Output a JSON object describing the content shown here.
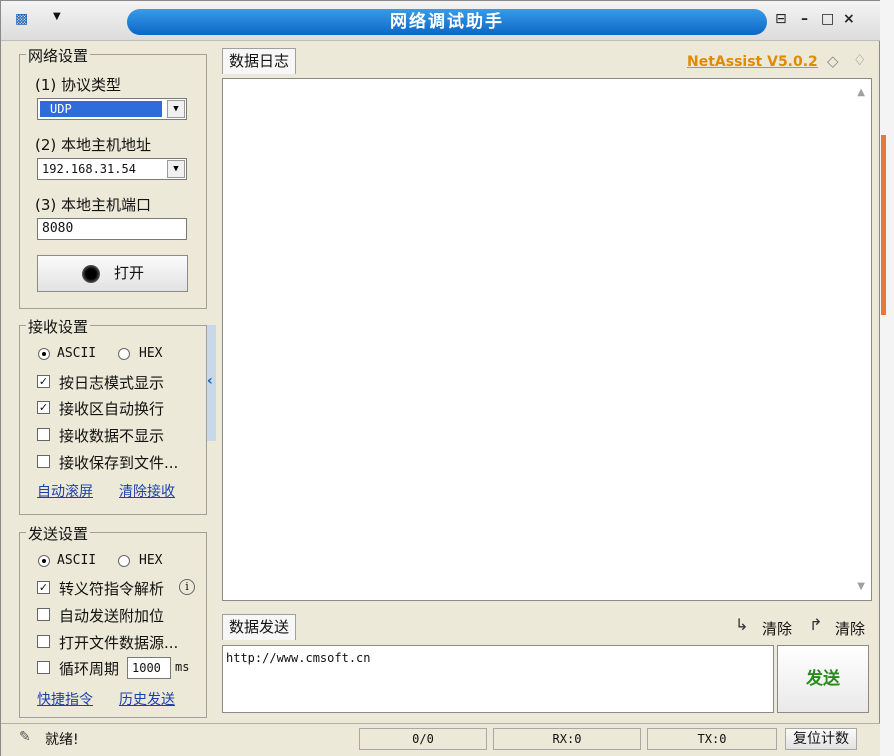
{
  "window": {
    "title": "网络调试助手",
    "controls": [
      "⊟",
      "–",
      "□",
      "×"
    ]
  },
  "network": {
    "group_title": "网络设置",
    "protocol_label": "(1) 协议类型",
    "protocol_value": "UDP",
    "host_label": "(2) 本地主机地址",
    "host_value": "192.168.31.54",
    "port_label": "(3) 本地主机端口",
    "port_value": "8080",
    "open_button": "打开"
  },
  "receive": {
    "group_title": "接收设置",
    "mode_ascii": "ASCII",
    "mode_hex": "HEX",
    "options": [
      "按日志模式显示",
      "接收区自动换行",
      "接收数据不显示",
      "接收保存到文件..."
    ],
    "checked": [
      true,
      true,
      false,
      false
    ],
    "link_autoscroll": "自动滚屏",
    "link_clear": "清除接收"
  },
  "send": {
    "group_title": "发送设置",
    "mode_ascii": "ASCII",
    "mode_hex": "HEX",
    "opt_escape": "转义符指令解析",
    "opt_autoappend": "自动发送附加位",
    "opt_openfile": "打开文件数据源...",
    "opt_cycle": "循环周期",
    "cycle_value": "1000",
    "cycle_unit": "ms",
    "link_shortcut": "快捷指令",
    "link_history": "历史发送"
  },
  "main": {
    "log_tab": "数据日志",
    "brand": "NetAssist V5.0.2",
    "send_tab": "数据发送",
    "clear1": "清除",
    "clear2": "清除",
    "send_text": "http://www.cmsoft.cn",
    "send_button": "发送"
  },
  "status": {
    "text": "就绪!",
    "counter": "0/0",
    "rx": "RX:0",
    "tx": "TX:0",
    "reset": "复位计数"
  },
  "colors": {
    "title_blue": "#0a67c7",
    "brand_orange": "#e08a00",
    "send_green": "#2b8a1e",
    "link_blue": "#1c3fae"
  }
}
